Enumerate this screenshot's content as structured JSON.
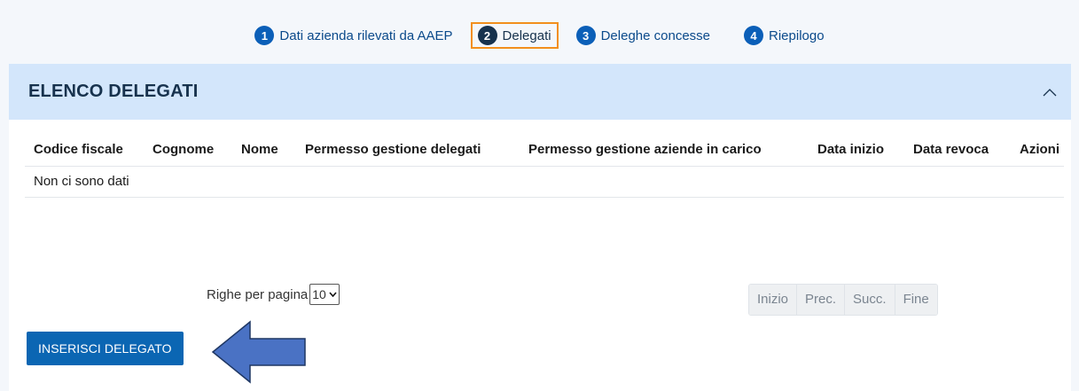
{
  "stepper": {
    "steps": [
      {
        "number": "1",
        "label": "Dati azienda rilevati da AAEP"
      },
      {
        "number": "2",
        "label": "Delegati"
      },
      {
        "number": "3",
        "label": "Deleghe concesse"
      },
      {
        "number": "4",
        "label": "Riepilogo"
      }
    ],
    "active_index": 1
  },
  "panel": {
    "title": "ELENCO DELEGATI",
    "collapse_icon": "chevron-up-icon"
  },
  "table": {
    "columns": [
      "Codice fiscale",
      "Cognome",
      "Nome",
      "Permesso gestione delegati",
      "Permesso gestione aziende in carico",
      "Data inizio",
      "Data revoca",
      "Azioni"
    ],
    "empty_message": "Non ci sono dati"
  },
  "pagination": {
    "rows_label": "Righe per pagina",
    "rows_value": "10",
    "buttons": [
      "Inizio",
      "Prec.",
      "Succ.",
      "Fine"
    ]
  },
  "actions": {
    "insert_label": "INSERISCI DELEGATO"
  },
  "colors": {
    "accent": "#0b66b3",
    "header_bg": "#d3e6fb",
    "active_step_border": "#f28f1c",
    "arrow": "#4a72c4"
  }
}
